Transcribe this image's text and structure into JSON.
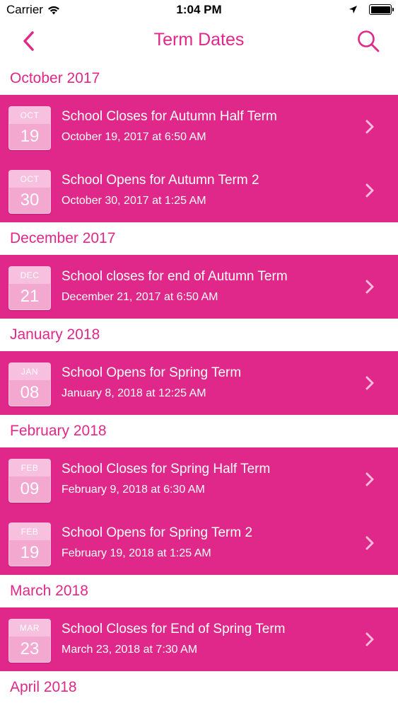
{
  "status_bar": {
    "carrier": "Carrier",
    "time": "1:04 PM",
    "icons": [
      "wifi-icon",
      "location-arrow-icon",
      "battery-icon"
    ]
  },
  "nav": {
    "back_icon": "chevron-left-icon",
    "title": "Term Dates",
    "search_icon": "search-icon",
    "accent_color": "#e0288a"
  },
  "sections": [
    {
      "header": "October 2017",
      "items": [
        {
          "month": "OCT",
          "day": "19",
          "title": "School Closes for Autumn Half Term",
          "datetime": "October 19, 2017 at 6:50 AM"
        },
        {
          "month": "OCT",
          "day": "30",
          "title": "School Opens for Autumn Term 2",
          "datetime": "October 30, 2017 at 1:25 AM"
        }
      ]
    },
    {
      "header": "December 2017",
      "items": [
        {
          "month": "DEC",
          "day": "21",
          "title": "School closes for end of Autumn Term",
          "datetime": "December 21, 2017 at 6:50 AM"
        }
      ]
    },
    {
      "header": "January 2018",
      "items": [
        {
          "month": "JAN",
          "day": "08",
          "title": "School Opens for Spring Term",
          "datetime": "January 8, 2018 at 12:25 AM"
        }
      ]
    },
    {
      "header": "February 2018",
      "items": [
        {
          "month": "FEB",
          "day": "09",
          "title": "School Closes for Spring Half Term",
          "datetime": "February 9, 2018 at 6:30 AM"
        },
        {
          "month": "FEB",
          "day": "19",
          "title": "School Opens for Spring Term 2",
          "datetime": "February 19, 2018 at 1:25 AM"
        }
      ]
    },
    {
      "header": "March 2018",
      "items": [
        {
          "month": "MAR",
          "day": "23",
          "title": "School Closes for End of Spring Term",
          "datetime": "March 23, 2018 at 7:30 AM"
        }
      ]
    },
    {
      "header": "April 2018",
      "items": []
    }
  ]
}
